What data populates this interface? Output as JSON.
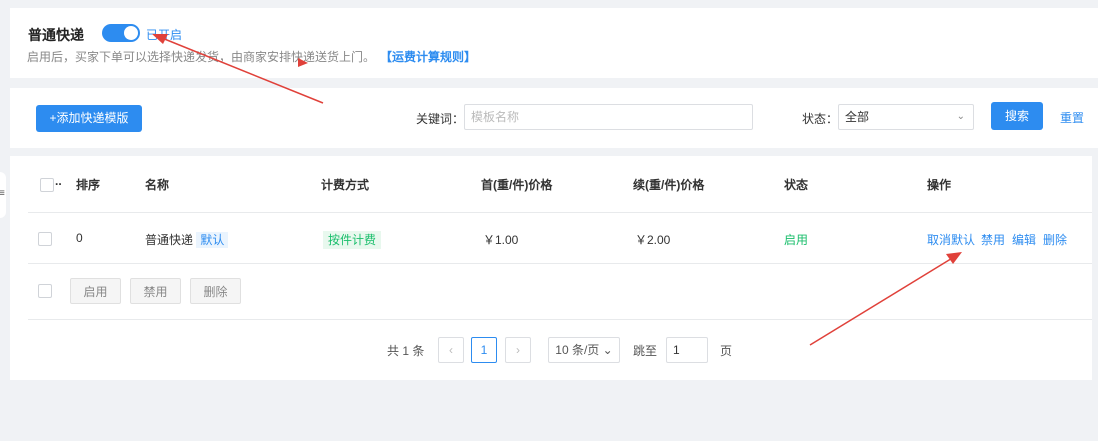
{
  "top": {
    "title": "普通快递",
    "switch_label": "已开启",
    "description": "启用后，买家下单可以选择快递发货，由商家安排快递送货上门。",
    "rule_link": "【运费计算规则】"
  },
  "search": {
    "add_button": "+添加快递模版",
    "keyword_label": "关键词：",
    "keyword_placeholder": "模板名称",
    "keyword_value": "",
    "status_label": "状态：",
    "status_value": "全部",
    "search_button": "搜索",
    "reset_link": "重置"
  },
  "table": {
    "headers": {
      "select": "..",
      "order": "排序",
      "name": "名称",
      "billing": "计费方式",
      "first_price": "首(重/件)价格",
      "next_price": "续(重/件)价格",
      "status": "状态",
      "actions": "操作"
    },
    "rows": [
      {
        "order": "0",
        "name": "普通快递",
        "default_tag": "默认",
        "billing": "按件计费",
        "first_price": "￥1.00",
        "next_price": "￥2.00",
        "status": "启用",
        "actions": {
          "cancel_default": "取消默认",
          "disable": "禁用",
          "edit": "编辑",
          "delete": "删除"
        }
      }
    ],
    "batch": {
      "enable": "启用",
      "disable": "禁用",
      "delete": "删除"
    }
  },
  "pagination": {
    "total": "共 1 条",
    "prev": "‹",
    "current": "1",
    "next": "›",
    "page_size": "10 条/页",
    "jump_label": "跳至",
    "jump_value": "1",
    "page_unit": "页"
  },
  "colors": {
    "primary": "#2d8cf0",
    "success": "#19be6b",
    "annotation_arrow": "#e0413a"
  }
}
